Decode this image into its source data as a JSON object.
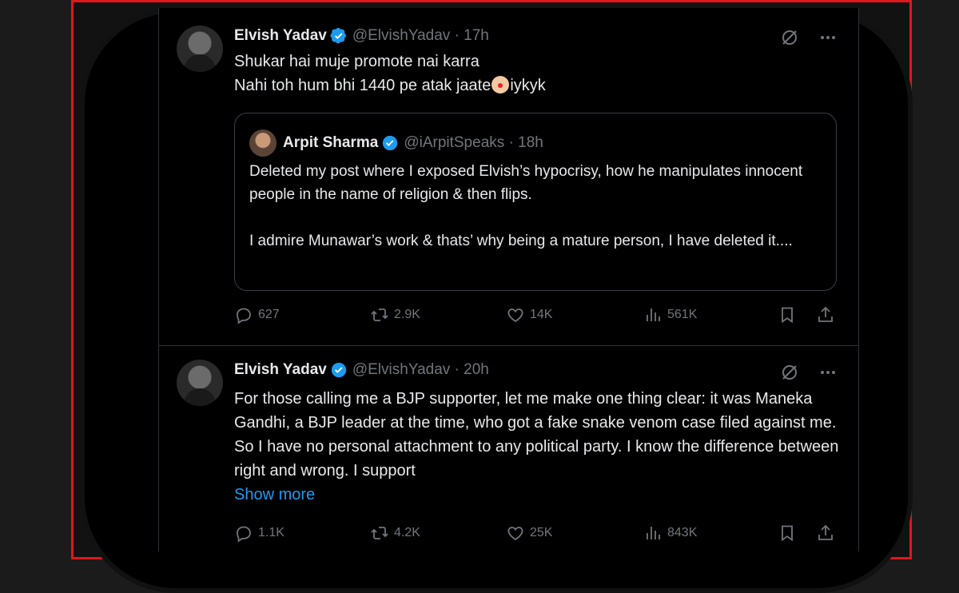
{
  "tweets": [
    {
      "name": "Elvish Yadav",
      "handle": "@ElvishYadav · 17h",
      "lines": [
        "Shukar hai muje promote nai karra",
        "Nahi toh hum bhi 1440 pe atak jaate",
        "iykyk"
      ],
      "quote": {
        "name": "Arpit Sharma",
        "handle": "@iArpitSpeaks · 18h",
        "paragraph1": "Deleted my post where I exposed Elvish’s hypocrisy, how he manipulates innocent people in the name of religion & then flips.",
        "paragraph2": "I admire Munawar’s work & thats’ why being a mature person, I have deleted it...."
      },
      "replies": "627",
      "retweets": "2.9K",
      "likes": "14K",
      "views": "561K"
    },
    {
      "name": "Elvish Yadav",
      "handle": "@ElvishYadav · 20h",
      "text": "For those calling me a BJP supporter, let me make one thing clear: it was Maneka Gandhi, a BJP leader at the time, who got a fake snake venom case filed against me. So I have no personal attachment to any political party. I know the difference between right and wrong. I support",
      "show_more": "Show more",
      "replies": "1.1K",
      "retweets": "4.2K",
      "likes": "25K",
      "views": "843K"
    }
  ],
  "icons": {
    "verified": "verified-badge-icon",
    "grok": "grok-icon",
    "more": "more-icon",
    "reply": "reply-icon",
    "retweet": "retweet-icon",
    "like": "heart-icon",
    "views": "views-icon",
    "bookmark": "bookmark-icon",
    "share": "share-icon"
  },
  "colors": {
    "frame": "#e0171b",
    "accent": "#1d9bf0",
    "muted": "#71767b"
  }
}
